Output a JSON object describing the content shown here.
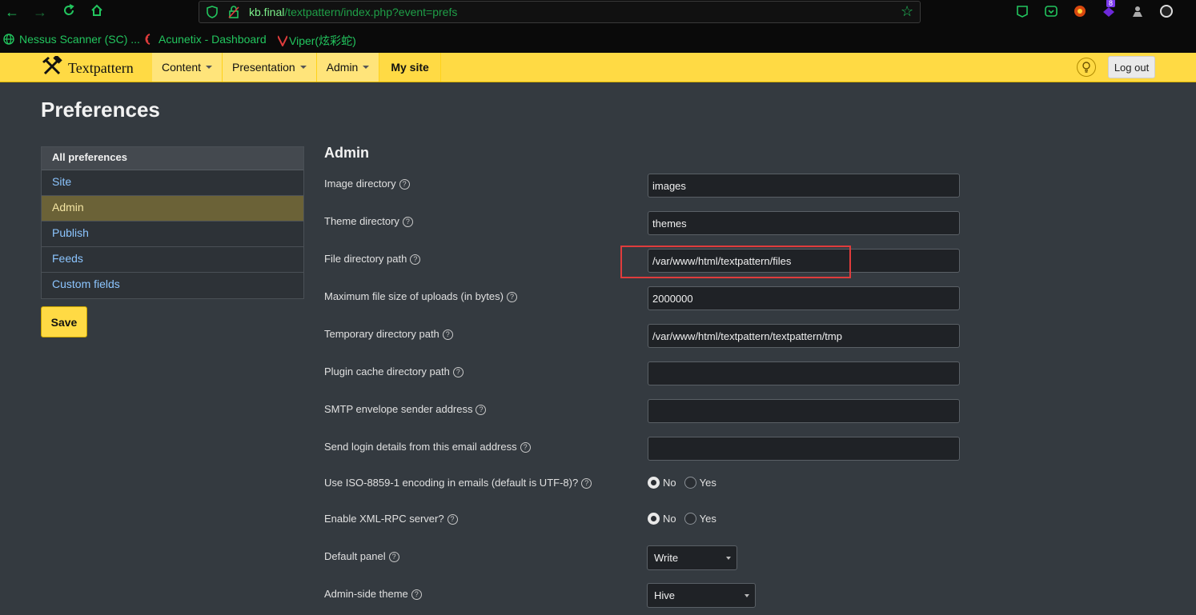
{
  "browser": {
    "url_host": "kb.final",
    "url_path": "/textpattern/index.php?event=prefs",
    "extension_badge": "8",
    "bookmarks": [
      {
        "label": "Nessus Scanner (SC) ..."
      },
      {
        "label": "Acunetix - Dashboard"
      },
      {
        "label": "Viper(炫彩蛇)"
      }
    ],
    "colors": {
      "accent": "#22c55e"
    }
  },
  "header": {
    "brand": "Textpattern",
    "nav": [
      {
        "label": "Content"
      },
      {
        "label": "Presentation"
      },
      {
        "label": "Admin"
      },
      {
        "label": "My site"
      }
    ],
    "logout_label": "Log out",
    "colors": {
      "bar": "#ffda44"
    }
  },
  "page": {
    "title": "Preferences",
    "sidebar": {
      "heading": "All preferences",
      "items": [
        {
          "label": "Site"
        },
        {
          "label": "Admin"
        },
        {
          "label": "Publish"
        },
        {
          "label": "Feeds"
        },
        {
          "label": "Custom fields"
        }
      ],
      "active": "Admin"
    },
    "save_label": "Save",
    "section_title": "Admin",
    "fields": [
      {
        "label": "Image directory",
        "value": "images"
      },
      {
        "label": "Theme directory",
        "value": "themes"
      },
      {
        "label": "File directory path",
        "value": "/var/www/html/textpattern/files"
      },
      {
        "label": "Maximum file size of uploads (in bytes)",
        "value": "2000000"
      },
      {
        "label": "Temporary directory path",
        "value": "/var/www/html/textpattern/textpattern/tmp"
      },
      {
        "label": "Plugin cache directory path",
        "value": ""
      },
      {
        "label": "SMTP envelope sender address",
        "value": ""
      },
      {
        "label": "Send login details from this email address",
        "value": ""
      }
    ],
    "radios": [
      {
        "label": "Use ISO-8859-1 encoding in emails (default is UTF-8)?",
        "no": "No",
        "yes": "Yes",
        "selected": "No"
      },
      {
        "label": "Enable XML-RPC server?",
        "no": "No",
        "yes": "Yes",
        "selected": "No"
      }
    ],
    "selects": [
      {
        "label": "Default panel",
        "value": "Write"
      },
      {
        "label": "Admin-side theme",
        "value": "Hive"
      }
    ]
  }
}
